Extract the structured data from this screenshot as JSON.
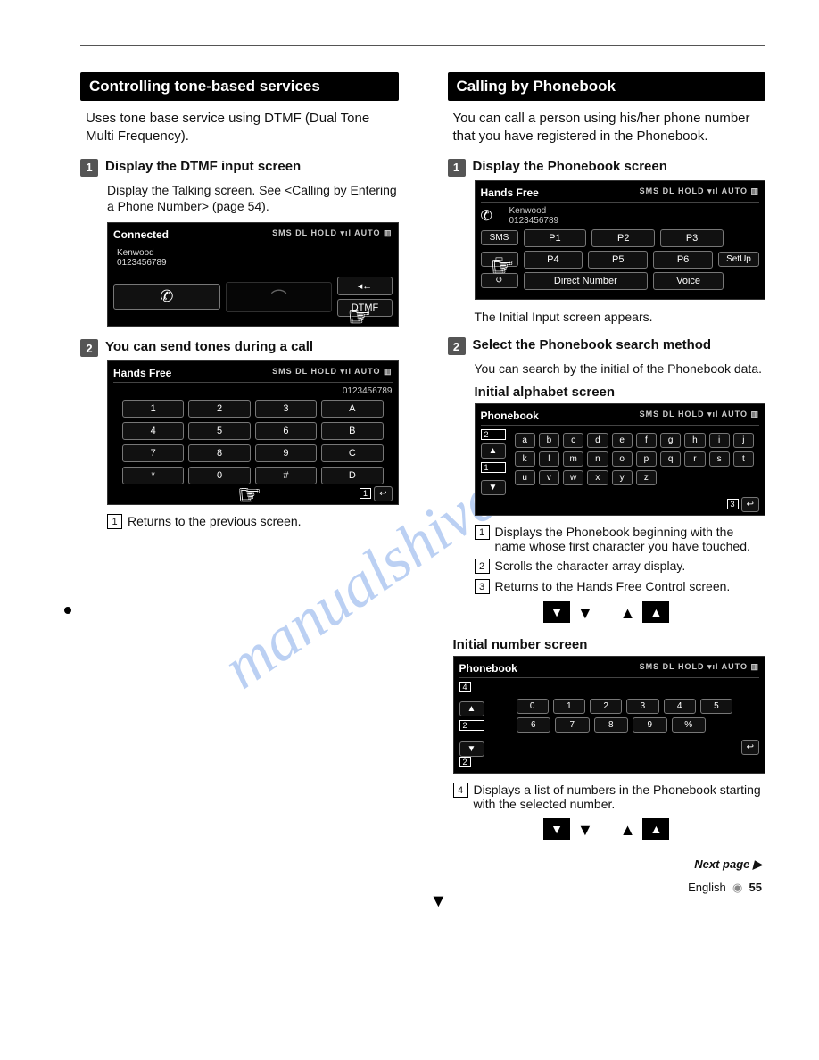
{
  "left": {
    "heading": "Controlling tone-based services",
    "intro": "Uses tone base service using DTMF (Dual Tone Multi Frequency).",
    "step1": {
      "num": "1",
      "title": "Display the DTMF input screen",
      "sub": "Display the Talking screen. See <Calling by Entering a Phone Number> (page 54)."
    },
    "ss1": {
      "title": "Connected",
      "icons": "SMS  DL  HOLD  ▾ıl  AUTO  ▥",
      "name": "Kenwood",
      "num": "0123456789",
      "dtmf": "DTMF",
      "spk": "◂←"
    },
    "step2": {
      "num": "2",
      "title": "You can send tones during a call"
    },
    "ss2": {
      "title": "Hands Free",
      "icons": "SMS  DL  HOLD  ▾ıl  AUTO  ▥",
      "num": "0123456789",
      "keys": [
        "1",
        "2",
        "3",
        "A",
        "4",
        "5",
        "6",
        "B",
        "7",
        "8",
        "9",
        "C",
        "*",
        "0",
        "#",
        "D"
      ]
    },
    "callout1": {
      "n": "1",
      "t": "Returns to the previous screen."
    }
  },
  "right": {
    "heading": "Calling by Phonebook",
    "intro": "You can call a person using his/her phone number that you have registered in the Phonebook.",
    "step1": {
      "num": "1",
      "title": "Display the Phonebook screen"
    },
    "ss1": {
      "title": "Hands Free",
      "icons": "SMS  DL  HOLD  ▾ıl  AUTO  ▥",
      "name": "Kenwood",
      "num": "0123456789",
      "p": [
        "P1",
        "P2",
        "P3",
        "P4",
        "P5",
        "P6"
      ],
      "direct": "Direct Number",
      "voice": "Voice",
      "setup": "SetUp",
      "sms": "SMS"
    },
    "after1": "The Initial Input screen appears.",
    "step2": {
      "num": "2",
      "title": "Select the Phonebook search method"
    },
    "sub2": "You can search by the initial of the Phonebook data.",
    "subhA": "Initial alphabet screen",
    "ssA": {
      "title": "Phonebook",
      "icons": "SMS  DL  HOLD  ▾ıl  AUTO  ▥",
      "r1": [
        "a",
        "b",
        "c",
        "d",
        "e",
        "f",
        "g",
        "h",
        "i",
        "j"
      ],
      "r2": [
        "k",
        "l",
        "m",
        "n",
        "o",
        "p",
        "q",
        "r",
        "s",
        "t"
      ],
      "r3": [
        "u",
        "v",
        "w",
        "x",
        "y",
        "z"
      ]
    },
    "coA": [
      {
        "n": "1",
        "t": "Displays the Phonebook beginning with the name whose first character you have touched."
      },
      {
        "n": "2",
        "t": "Scrolls the character array display."
      },
      {
        "n": "3",
        "t": "Returns to the Hands Free Control screen."
      }
    ],
    "subhN": "Initial number screen",
    "ssN": {
      "title": "Phonebook",
      "icons": "SMS  DL  HOLD  ▾ıl  AUTO  ▥",
      "r1": [
        "0",
        "1",
        "2",
        "3",
        "4",
        "5"
      ],
      "r2": [
        "6",
        "7",
        "8",
        "9",
        "%"
      ]
    },
    "coN": {
      "n": "4",
      "t": "Displays a list of numbers in the Phonebook starting with the selected number."
    }
  },
  "footer": {
    "next": "Next page ▶",
    "lang": "English",
    "page": "55"
  },
  "watermark": "manualshive.com"
}
